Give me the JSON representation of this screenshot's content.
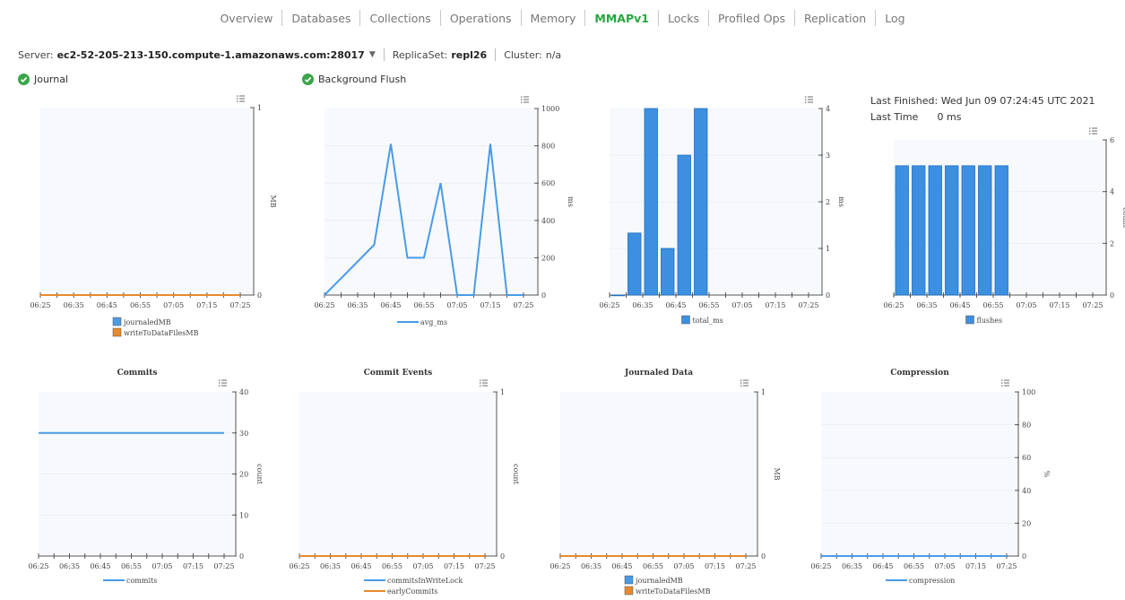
{
  "nav": {
    "items": [
      "Overview",
      "Databases",
      "Collections",
      "Operations",
      "Memory",
      "MMAPv1",
      "Locks",
      "Profiled Ops",
      "Replication",
      "Log"
    ],
    "active_index": 5,
    "active_color": "#27a63d"
  },
  "server_bar": {
    "server_label": "Server:",
    "server_value": "ec2-52-205-213-150.compute-1.amazonaws.com:28017",
    "replicaset_label": "ReplicaSet:",
    "replicaset_value": "repl26",
    "cluster_label": "Cluster:",
    "cluster_value": "n/a"
  },
  "sections": {
    "journal_title": "Journal",
    "flush_title": "Background Flush",
    "status_icon": "check-circle-icon",
    "status_color": "#3aa548"
  },
  "flush_info": {
    "last_finished_label": "Last Finished:",
    "last_finished_value": "Wed Jun 09 07:24:45 UTC 2021",
    "last_time_label": "Last Time",
    "last_time_value": "0 ms"
  },
  "colors": {
    "blue": "#4a9be6",
    "orange": "#e8892e",
    "bar_fill": "#3d8fe0",
    "bar_stroke": "#1f6fc5"
  },
  "chart_data": [
    {
      "type": "line",
      "menu_icon": "chart-menu-icon",
      "title": "",
      "ylabel": "MB",
      "ylim": [
        0,
        1
      ],
      "yticks": [
        0,
        1
      ],
      "x": [
        "06:25",
        "06:35",
        "06:45",
        "06:55",
        "07:05",
        "07:15",
        "07:25"
      ],
      "series": [
        {
          "name": "journaledMB",
          "values": [
            0,
            0,
            0,
            0,
            0,
            0,
            0
          ],
          "color": "#4a9be6"
        },
        {
          "name": "writeToDataFilesMB",
          "values": [
            0,
            0,
            0,
            0,
            0,
            0,
            0
          ],
          "color": "#e8892e"
        }
      ],
      "legend_style": "box"
    },
    {
      "type": "line",
      "menu_icon": "chart-menu-icon",
      "title": "",
      "ylabel": "ms",
      "ylim": [
        0,
        1000
      ],
      "yticks": [
        0,
        200,
        400,
        600,
        800,
        1000
      ],
      "x": [
        "06:25",
        "06:35",
        "06:45",
        "06:55",
        "07:05",
        "07:15",
        "07:25"
      ],
      "points_x_minutes": [
        0,
        15,
        20,
        25,
        30,
        35,
        40,
        45,
        50,
        55,
        60
      ],
      "series": [
        {
          "name": "avg_ms",
          "values": [
            0,
            270,
            810,
            200,
            200,
            600,
            0,
            0,
            810,
            0,
            0
          ],
          "color": "#4a9be6"
        }
      ],
      "legend_style": "line"
    },
    {
      "type": "bar",
      "menu_icon": "chart-menu-icon",
      "title": "",
      "ylabel": "ms",
      "ylim": [
        0,
        4
      ],
      "yticks": [
        0,
        1,
        2,
        3,
        4
      ],
      "x": [
        "06:25",
        "06:35",
        "06:45",
        "06:55",
        "07:05",
        "07:15",
        "07:25"
      ],
      "series": [
        {
          "name": "total_ms",
          "values": [
            0,
            1.33,
            4,
            1,
            3,
            4
          ],
          "color": "#3d8fe0"
        }
      ],
      "legend_style": "box"
    },
    {
      "type": "bar",
      "menu_icon": "chart-menu-icon",
      "title": "",
      "ylabel": "count",
      "ylim": [
        0,
        6
      ],
      "yticks": [
        0,
        2,
        4,
        6
      ],
      "x": [
        "06:25",
        "06:35",
        "06:45",
        "06:55",
        "07:05",
        "07:15",
        "07:25"
      ],
      "series": [
        {
          "name": "flushes",
          "values": [
            5,
            5,
            5,
            5,
            5,
            5,
            5
          ],
          "color": "#3d8fe0"
        }
      ],
      "legend_style": "box"
    },
    {
      "type": "line",
      "menu_icon": "chart-menu-icon",
      "title": "Commits",
      "ylabel": "count",
      "ylim": [
        0,
        40
      ],
      "yticks": [
        0,
        10,
        20,
        30,
        40
      ],
      "x": [
        "06:25",
        "06:35",
        "06:45",
        "06:55",
        "07:05",
        "07:15",
        "07:25"
      ],
      "series": [
        {
          "name": "commits",
          "values": [
            30,
            30,
            30,
            30,
            30,
            30,
            30
          ],
          "color": "#4a9be6"
        }
      ],
      "legend_style": "line"
    },
    {
      "type": "line",
      "menu_icon": "chart-menu-icon",
      "title": "Commit Events",
      "ylabel": "count",
      "ylim": [
        0,
        1
      ],
      "yticks": [
        0,
        1
      ],
      "x": [
        "06:25",
        "06:35",
        "06:45",
        "06:55",
        "07:05",
        "07:15",
        "07:25"
      ],
      "series": [
        {
          "name": "commitsInWriteLock",
          "values": [
            0,
            0,
            0,
            0,
            0,
            0,
            0
          ],
          "color": "#4a9be6"
        },
        {
          "name": "earlyCommits",
          "values": [
            0,
            0,
            0,
            0,
            0,
            0,
            0
          ],
          "color": "#e8892e"
        }
      ],
      "legend_style": "line"
    },
    {
      "type": "line",
      "menu_icon": "chart-menu-icon",
      "title": "Journaled Data",
      "ylabel": "MB",
      "ylim": [
        0,
        1
      ],
      "yticks": [
        0,
        1
      ],
      "x": [
        "06:25",
        "06:35",
        "06:45",
        "06:55",
        "07:05",
        "07:15",
        "07:25"
      ],
      "series": [
        {
          "name": "journaledMB",
          "values": [
            0,
            0,
            0,
            0,
            0,
            0,
            0
          ],
          "color": "#4a9be6"
        },
        {
          "name": "writeToDataFilesMB",
          "values": [
            0,
            0,
            0,
            0,
            0,
            0,
            0
          ],
          "color": "#e8892e"
        }
      ],
      "legend_style": "box"
    },
    {
      "type": "line",
      "menu_icon": "chart-menu-icon",
      "title": "Compression",
      "ylabel": "%",
      "ylim": [
        0,
        100
      ],
      "yticks": [
        0,
        20,
        40,
        60,
        80,
        100
      ],
      "x": [
        "06:25",
        "06:35",
        "06:45",
        "06:55",
        "07:05",
        "07:15",
        "07:25"
      ],
      "series": [
        {
          "name": "compression",
          "values": [
            0,
            0,
            0,
            0,
            0,
            0,
            0
          ],
          "color": "#4a9be6"
        }
      ],
      "legend_style": "line"
    }
  ]
}
